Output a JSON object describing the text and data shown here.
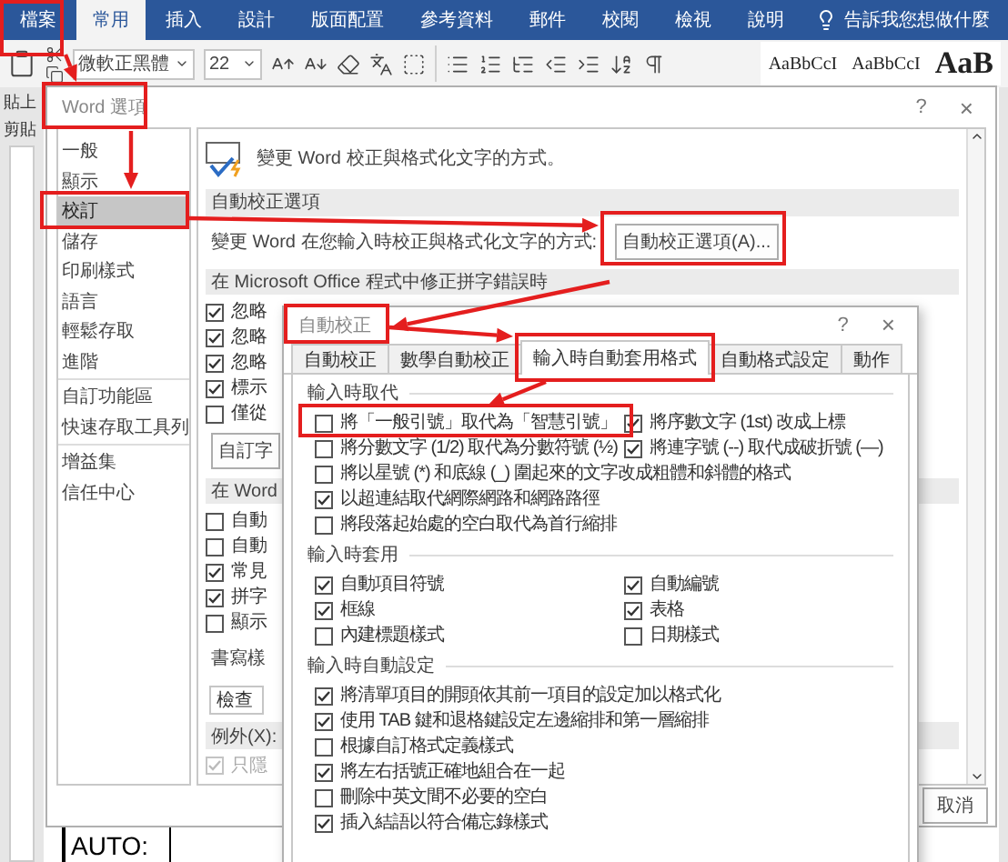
{
  "ribbon": {
    "tabs": [
      {
        "label": "檔案",
        "selected": false
      },
      {
        "label": "常用",
        "selected": true
      },
      {
        "label": "插入",
        "selected": false
      },
      {
        "label": "設計",
        "selected": false
      },
      {
        "label": "版面配置",
        "selected": false
      },
      {
        "label": "參考資料",
        "selected": false
      },
      {
        "label": "郵件",
        "selected": false
      },
      {
        "label": "校閱",
        "selected": false
      },
      {
        "label": "檢視",
        "selected": false
      },
      {
        "label": "說明",
        "selected": false
      }
    ],
    "tell_me": "告訴我您想做什麼",
    "font": "微軟正黑體",
    "font_size": "22",
    "styles": [
      "AaBbCcI",
      "AaBbCcI",
      "AaB"
    ],
    "paste": "貼上",
    "group_label": "剪貼"
  },
  "options_dialog": {
    "title": "Word 選項",
    "help": "?",
    "close": "×",
    "nav_groups": [
      [
        {
          "label": "一般",
          "selected": false
        },
        {
          "label": "顯示",
          "selected": false
        },
        {
          "label": "校訂",
          "selected": true
        },
        {
          "label": "儲存",
          "selected": false
        },
        {
          "label": "印刷樣式",
          "selected": false
        },
        {
          "label": "語言",
          "selected": false
        },
        {
          "label": "輕鬆存取",
          "selected": false
        },
        {
          "label": "進階",
          "selected": false
        }
      ],
      [
        {
          "label": "自訂功能區",
          "selected": false
        },
        {
          "label": "快速存取工具列",
          "selected": false
        }
      ],
      [
        {
          "label": "增益集",
          "selected": false
        },
        {
          "label": "信任中心",
          "selected": false
        }
      ]
    ],
    "heading": "變更 Word 校正與格式化文字的方式。",
    "autocorrect_band": "自動校正選項",
    "autocorrect_hint": "變更 Word 在您輸入時校正與格式化文字的方式:",
    "autocorrect_button": "自動校正選項(A)...",
    "office_band": "在 Microsoft Office 程式中修正拼字錯誤時",
    "office_options": [
      {
        "label": "忽略",
        "checked": true
      },
      {
        "label": "忽略",
        "checked": true
      },
      {
        "label": "忽略",
        "checked": true
      },
      {
        "label": "標示",
        "checked": true
      },
      {
        "label": "僅從",
        "checked": false
      }
    ],
    "dictionary_button": "自訂字",
    "word_band": "在 Word",
    "word_options": [
      {
        "label": "自動",
        "checked": false
      },
      {
        "label": "自動",
        "checked": false
      },
      {
        "label": "常見",
        "checked": true
      },
      {
        "label": "拼字",
        "checked": true
      },
      {
        "label": "顯示",
        "checked": false
      }
    ],
    "style_label": "書寫樣",
    "style_value": "檢查",
    "exceptions_label": "例外(X):",
    "exception_options": [
      {
        "label": "只隱",
        "checked": true,
        "disabled": true
      }
    ],
    "cancel": "取消"
  },
  "autocorrect_dialog": {
    "title": "自動校正",
    "help": "?",
    "close": "×",
    "tabs": [
      {
        "label": "自動校正",
        "selected": false
      },
      {
        "label": "數學自動校正",
        "selected": false
      },
      {
        "label": "輸入時自動套用格式",
        "selected": true
      },
      {
        "label": "自動格式設定",
        "selected": false
      },
      {
        "label": "動作",
        "selected": false
      }
    ],
    "groups": [
      {
        "title": "輸入時取代",
        "left": [
          {
            "label": "將「一般引號」取代為「智慧引號」",
            "checked": false
          },
          {
            "label": "將分數文字 (1/2) 取代為分數符號 (½)",
            "checked": false
          },
          {
            "label": "將以星號 (*) 和底線 (_) 圍起來的文字改成粗體和斜體的格式",
            "checked": false
          },
          {
            "label": "以超連結取代網際網路和網路路徑",
            "checked": true
          },
          {
            "label": "將段落起始處的空白取代為首行縮排",
            "checked": false
          }
        ],
        "right": [
          {
            "label": "將序數文字 (1st) 改成上標",
            "checked": true
          },
          {
            "label": "將連字號 (--) 取代成破折號 (—)",
            "checked": true
          }
        ]
      },
      {
        "title": "輸入時套用",
        "left": [
          {
            "label": "自動項目符號",
            "checked": true
          },
          {
            "label": "框線",
            "checked": true
          },
          {
            "label": "內建標題樣式",
            "checked": false
          }
        ],
        "right": [
          {
            "label": "自動編號",
            "checked": true
          },
          {
            "label": "表格",
            "checked": true
          },
          {
            "label": "日期樣式",
            "checked": false
          }
        ]
      },
      {
        "title": "輸入時自動設定",
        "left": [
          {
            "label": "將清單項目的開頭依其前一項目的設定加以格式化",
            "checked": true
          },
          {
            "label": "使用 TAB 鍵和退格鍵設定左邊縮排和第一層縮排",
            "checked": true
          },
          {
            "label": "根據自訂格式定義樣式",
            "checked": false
          },
          {
            "label": "將左右括號正確地組合在一起",
            "checked": true
          },
          {
            "label": "刪除中英文間不必要的空白",
            "checked": false
          },
          {
            "label": "插入結語以符合備忘錄樣式",
            "checked": true
          }
        ]
      }
    ]
  },
  "document": {
    "cell": "AUTO:"
  }
}
